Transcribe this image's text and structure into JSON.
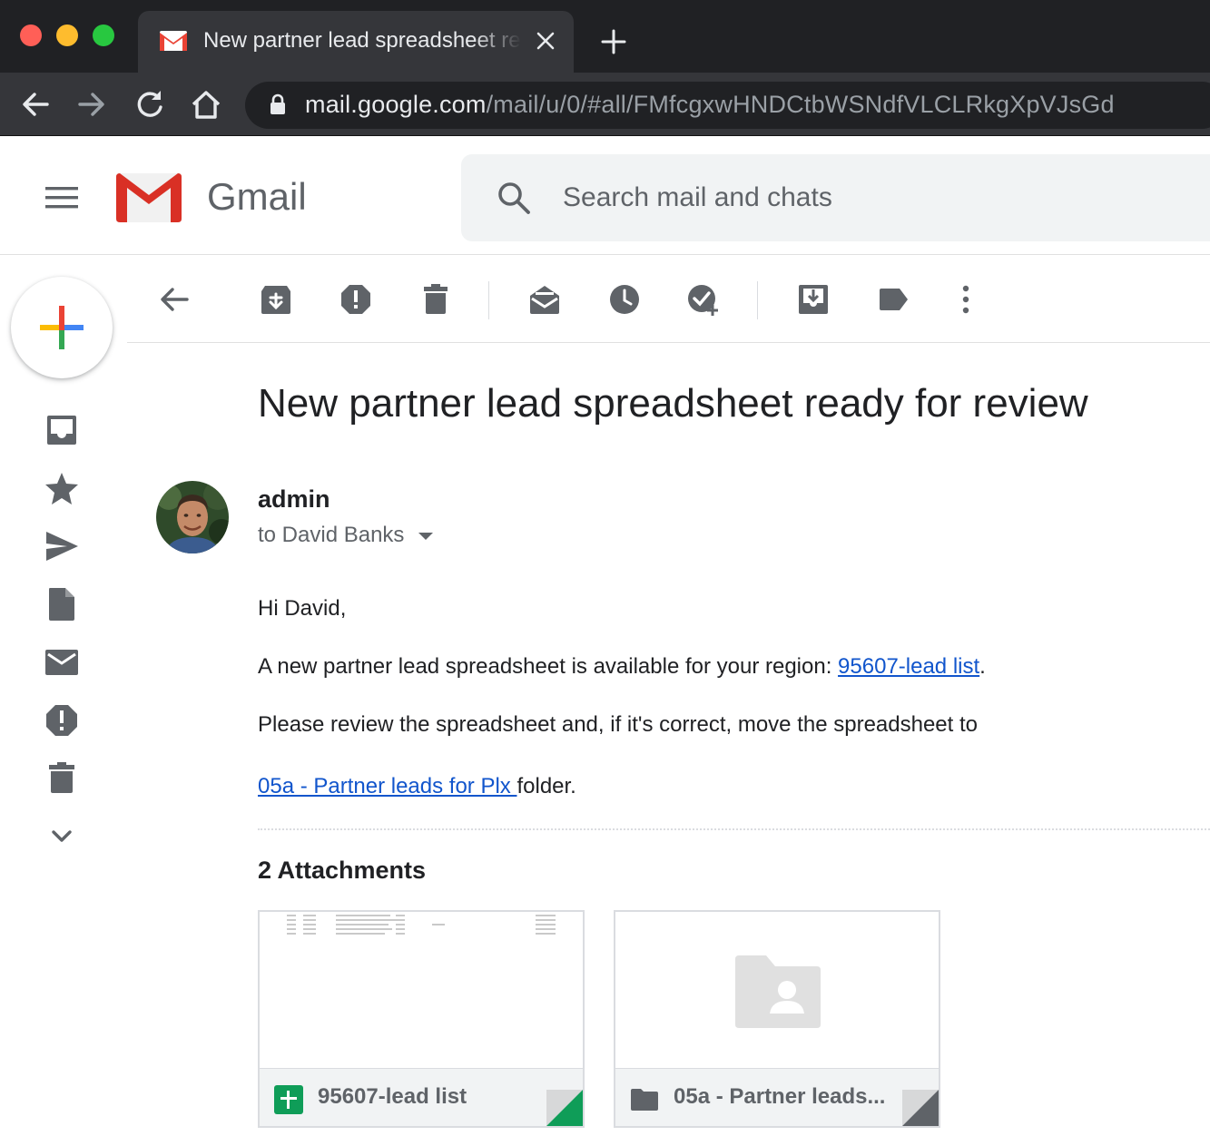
{
  "browser": {
    "tab_title": "New partner lead spreadsheet ready for review - Gmail",
    "url_host": "mail.google.com",
    "url_path": "/mail/u/0/#all/FMfcgxwHNDCtbWSNdfVLCLRkgXpVJsGd"
  },
  "gmail": {
    "brand": "Gmail",
    "search_placeholder": "Search mail and chats"
  },
  "message": {
    "subject": "New partner lead spreadsheet ready for review",
    "sender": "admin",
    "recipients": "to David Banks",
    "greeting": "Hi David,",
    "line1_text": "A new partner lead spreadsheet is available for your region: ",
    "line1_link": "95607-lead list",
    "line1_end": ".",
    "line2_text": "Please review the spreadsheet and, if it's correct, move the spreadsheet to",
    "line3_link": "05a - Partner leads for Plx ",
    "line3_end": "folder."
  },
  "attachments": {
    "heading": "2 Attachments",
    "items": [
      {
        "name": "95607-lead list",
        "type": "sheets-icon"
      },
      {
        "name": "05a - Partner leads...",
        "type": "folder-icon"
      }
    ]
  },
  "colors": {
    "link": "#1155cc",
    "sheets_green": "#0f9d58",
    "gmail_red": "#ea4335"
  }
}
